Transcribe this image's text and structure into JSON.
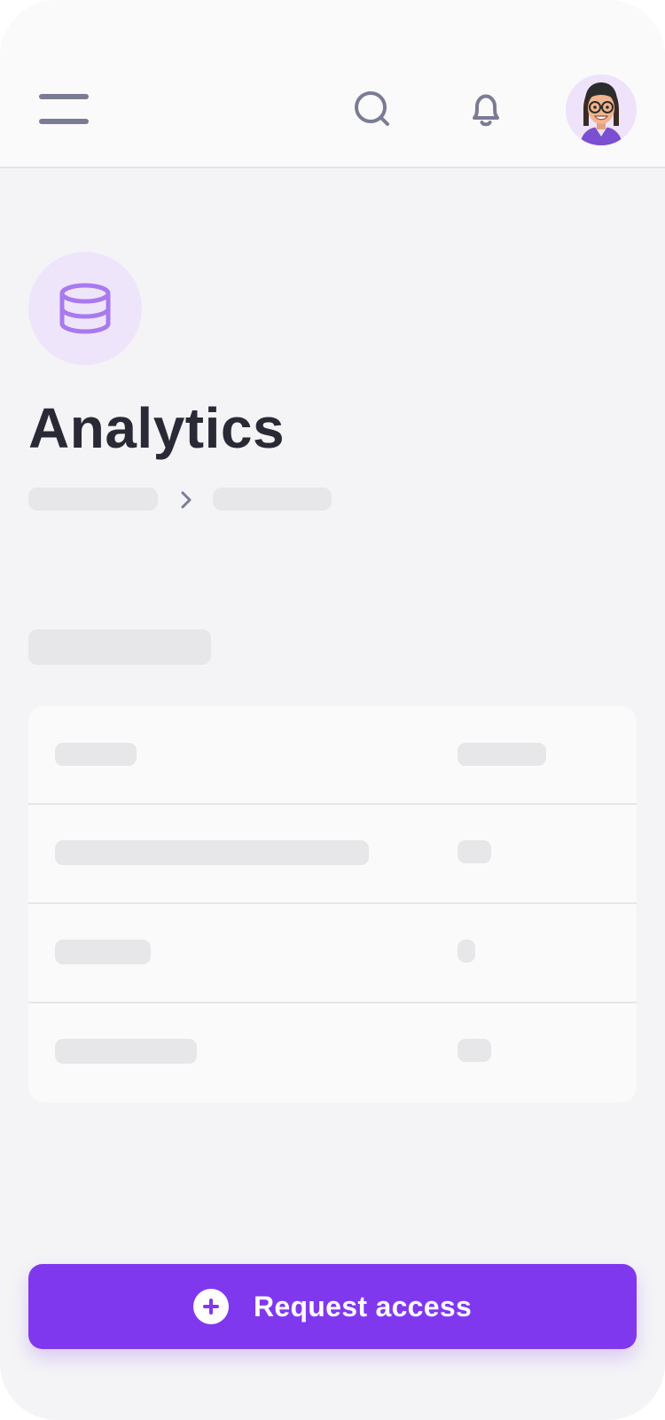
{
  "header": {
    "menu_icon": "hamburger-menu-icon",
    "search_icon": "search-icon",
    "notifications_icon": "bell-icon",
    "avatar": "user-avatar"
  },
  "hero": {
    "icon": "database-icon",
    "title": "Analytics"
  },
  "cta": {
    "icon": "plus-circle-icon",
    "label": "Request access"
  },
  "colors": {
    "accent": "#8038ef",
    "accent_soft": "#efe5fb",
    "icon_purple": "#a97aef",
    "title": "#2a2a36",
    "header_icons": "#7a7b95",
    "skeleton": "#e7e7ea",
    "background": "#f4f4f6"
  }
}
